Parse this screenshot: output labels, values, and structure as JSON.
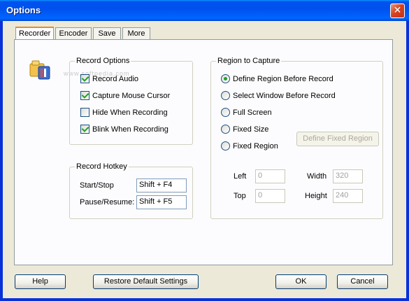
{
  "window": {
    "title": "Options",
    "close_glyph": "✕"
  },
  "tabs": [
    {
      "label": "Recorder",
      "active": true
    },
    {
      "label": "Encoder",
      "active": false
    },
    {
      "label": "Save",
      "active": false
    },
    {
      "label": "More",
      "active": false
    }
  ],
  "watermark": "www.softpedia.com",
  "record_options": {
    "title": "Record Options",
    "items": [
      {
        "label": "Record Audio",
        "checked": true
      },
      {
        "label": "Capture Mouse Cursor",
        "checked": true
      },
      {
        "label": "Hide When Recording",
        "checked": false
      },
      {
        "label": "Blink When Recording",
        "checked": true
      }
    ]
  },
  "record_hotkey": {
    "title": "Record Hotkey",
    "start_stop_label": "Start/Stop",
    "start_stop_value": "Shift + F4",
    "pause_resume_label": "Pause/Resume:",
    "pause_resume_value": "Shift + F5"
  },
  "region": {
    "title": "Region to Capture",
    "options": [
      {
        "label": "Define Region Before Record",
        "checked": true
      },
      {
        "label": "Select Window Before Record",
        "checked": false
      },
      {
        "label": "Full Screen",
        "checked": false
      },
      {
        "label": "Fixed Size",
        "checked": false
      },
      {
        "label": "Fixed Region",
        "checked": false
      }
    ],
    "define_fixed_region_label": "Define Fixed Region",
    "left_label": "Left",
    "left_value": "0",
    "top_label": "Top",
    "top_value": "0",
    "width_label": "Width",
    "width_value": "320",
    "height_label": "Height",
    "height_value": "240"
  },
  "footer": {
    "help": "Help",
    "restore": "Restore Default Settings",
    "ok": "OK",
    "cancel": "Cancel"
  }
}
